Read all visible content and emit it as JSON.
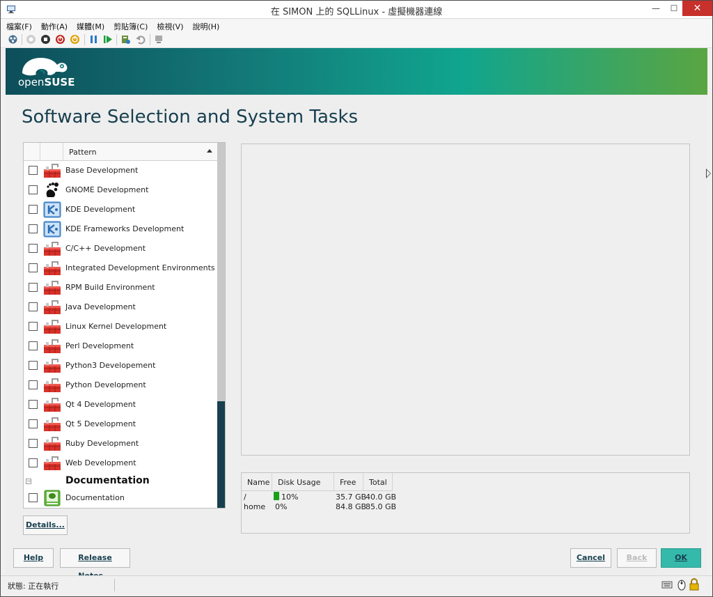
{
  "window": {
    "title": "在 SIMON 上的 SQLLinux - 虛擬機器連線",
    "min_glyph": "—",
    "max_glyph": "☐",
    "close_glyph": "✕"
  },
  "menu": [
    "檔案(F)",
    "動作(A)",
    "媒體(M)",
    "剪貼簿(C)",
    "檢視(V)",
    "說明(H)"
  ],
  "toolbar_icons": [
    "ctrl-alt-del-icon",
    "start-icon",
    "turn-off-icon",
    "shut-down-icon",
    "power-icon",
    "pause-icon",
    "resume-icon",
    "checkpoint-icon",
    "revert-icon",
    "enhanced-session-icon"
  ],
  "banner": {
    "logo_open": "open",
    "logo_suse": "SUSE",
    "colors": [
      "#0d4e5a",
      "#10a58f",
      "#5aa542"
    ]
  },
  "page": {
    "title": "Software Selection and System Tasks"
  },
  "patterns": {
    "column": "Pattern",
    "items": [
      {
        "label": "Base Development",
        "icon": "devel-icon"
      },
      {
        "label": "GNOME Development",
        "icon": "gnome-icon"
      },
      {
        "label": "KDE Development",
        "icon": "kde-icon"
      },
      {
        "label": "KDE Frameworks Development",
        "icon": "kde-icon"
      },
      {
        "label": "C/C++ Development",
        "icon": "devel-icon"
      },
      {
        "label": "Integrated Development Environments",
        "icon": "devel-icon"
      },
      {
        "label": "RPM Build Environment",
        "icon": "devel-icon"
      },
      {
        "label": "Java Development",
        "icon": "devel-icon"
      },
      {
        "label": "Linux Kernel Development",
        "icon": "devel-icon"
      },
      {
        "label": "Perl Development",
        "icon": "devel-icon"
      },
      {
        "label": "Python3 Developement",
        "icon": "devel-icon"
      },
      {
        "label": "Python Development",
        "icon": "devel-icon"
      },
      {
        "label": "Qt 4 Development",
        "icon": "devel-icon"
      },
      {
        "label": "Qt 5 Development",
        "icon": "devel-icon"
      },
      {
        "label": "Ruby Development",
        "icon": "devel-icon"
      },
      {
        "label": "Web Development",
        "icon": "devel-icon"
      }
    ],
    "group": {
      "toggle": "−",
      "label": "Documentation"
    },
    "group_items": [
      {
        "label": "Documentation",
        "icon": "documentation-icon"
      }
    ]
  },
  "disk": {
    "headers": [
      "Name",
      "Disk Usage",
      "Free",
      "Total"
    ],
    "rows": [
      {
        "name": "/",
        "usage": "10%",
        "usage_fraction": 0.1,
        "free": "35.7 GB",
        "total": "40.0 GB"
      },
      {
        "name": "home",
        "usage": "0%",
        "usage_fraction": 0.0,
        "free": "84.8 GB",
        "total": "85.0 GB"
      }
    ]
  },
  "buttons": {
    "details": "Details...",
    "help": "Help",
    "release_notes": "Release Notes...",
    "cancel": "Cancel",
    "back": "Back",
    "ok": "OK"
  },
  "status": {
    "text": "狀態: 正在執行"
  }
}
